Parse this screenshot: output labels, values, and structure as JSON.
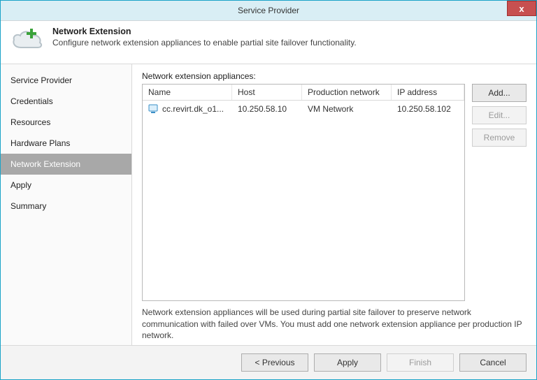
{
  "window": {
    "title": "Service Provider",
    "close_glyph": "x"
  },
  "header": {
    "title": "Network Extension",
    "subtitle": "Configure network extension appliances to enable partial site failover functionality."
  },
  "sidebar": {
    "items": [
      {
        "label": "Service Provider",
        "active": false
      },
      {
        "label": "Credentials",
        "active": false
      },
      {
        "label": "Resources",
        "active": false
      },
      {
        "label": "Hardware Plans",
        "active": false
      },
      {
        "label": "Network Extension",
        "active": true
      },
      {
        "label": "Apply",
        "active": false
      },
      {
        "label": "Summary",
        "active": false
      }
    ]
  },
  "content": {
    "list_label": "Network extension appliances:",
    "columns": {
      "name": "Name",
      "host": "Host",
      "network": "Production network",
      "ip": "IP address"
    },
    "rows": [
      {
        "name": "cc.revirt.dk_o1...",
        "host": "10.250.58.10",
        "network": "VM Network",
        "ip": "10.250.58.102"
      }
    ],
    "buttons": {
      "add": "Add...",
      "edit": "Edit...",
      "remove": "Remove"
    },
    "note": "Network extension appliances will be used during partial site failover to preserve network communication with failed over VMs. You must add one network extension appliance per production IP network."
  },
  "footer": {
    "previous": "< Previous",
    "apply": "Apply",
    "finish": "Finish",
    "cancel": "Cancel"
  }
}
